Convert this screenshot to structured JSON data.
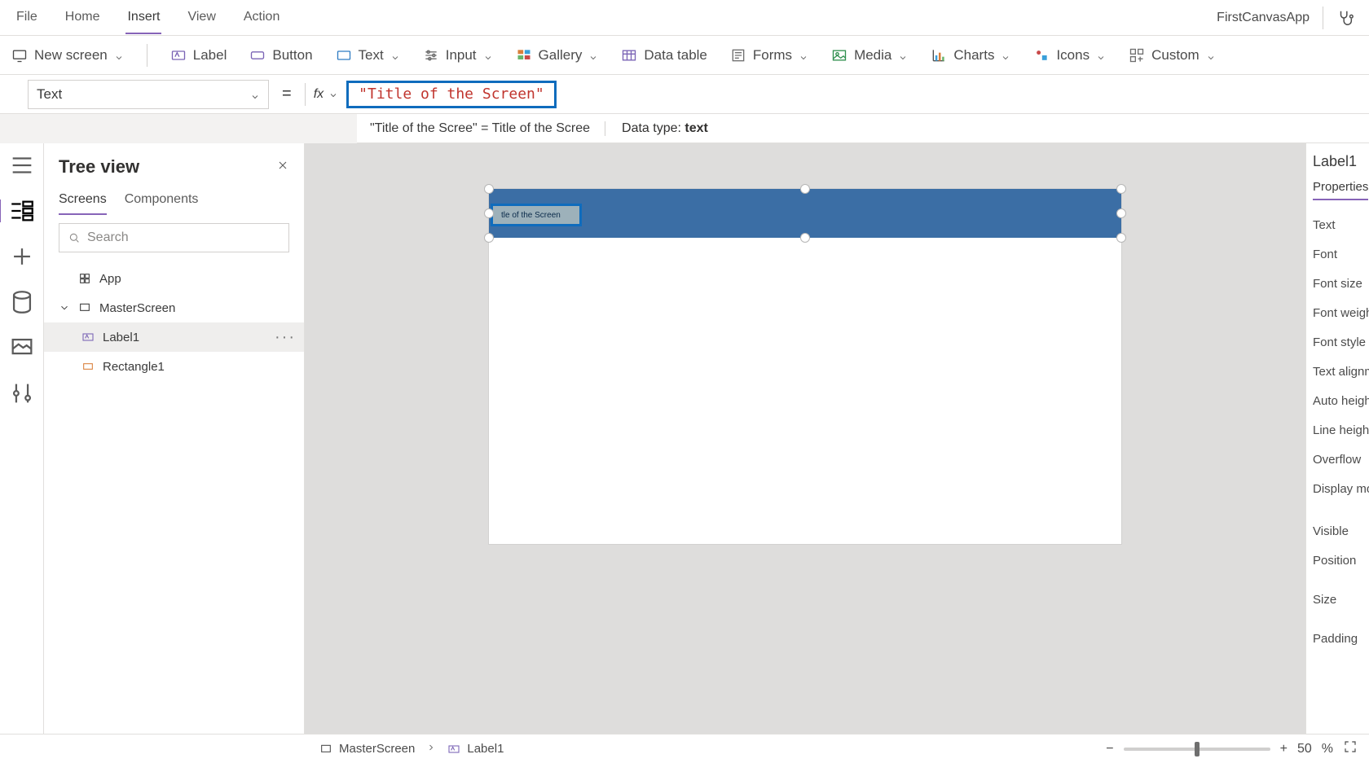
{
  "app": {
    "name": "FirstCanvasApp"
  },
  "menu": {
    "items": [
      "File",
      "Home",
      "Insert",
      "View",
      "Action"
    ],
    "activeIndex": 2
  },
  "ribbon": {
    "newScreen": "New screen",
    "label": "Label",
    "button": "Button",
    "text": "Text",
    "input": "Input",
    "gallery": "Gallery",
    "dataTable": "Data table",
    "forms": "Forms",
    "media": "Media",
    "charts": "Charts",
    "icons": "Icons",
    "custom": "Custom"
  },
  "formula": {
    "property": "Text",
    "equals": "=",
    "fx": "fx",
    "value": "\"Title of the Screen\""
  },
  "result": {
    "left": "\"Title of the Scree\"  =  Title of the Scree",
    "datatypeLabel": "Data type:",
    "datatype": "text"
  },
  "tree": {
    "title": "Tree view",
    "tabs": {
      "screens": "Screens",
      "components": "Components",
      "activeIndex": 0
    },
    "searchPlaceholder": "Search",
    "app": "App",
    "items": [
      "MasterScreen",
      "Label1",
      "Rectangle1"
    ],
    "selected": "Label1"
  },
  "canvas": {
    "labelText": "tle of the Screen"
  },
  "props": {
    "title": "Label1",
    "tab": "Properties",
    "rows": [
      "Text",
      "Font",
      "Font size",
      "Font weight",
      "Font style",
      "Text alignm",
      "Auto height",
      "Line height",
      "Overflow",
      "Display mo",
      "Visible",
      "Position",
      "Size",
      "Padding"
    ]
  },
  "status": {
    "crumbs": [
      "MasterScreen",
      "Label1"
    ],
    "zoom": {
      "minus": "−",
      "plus": "+",
      "value": "50",
      "unit": "%"
    }
  }
}
